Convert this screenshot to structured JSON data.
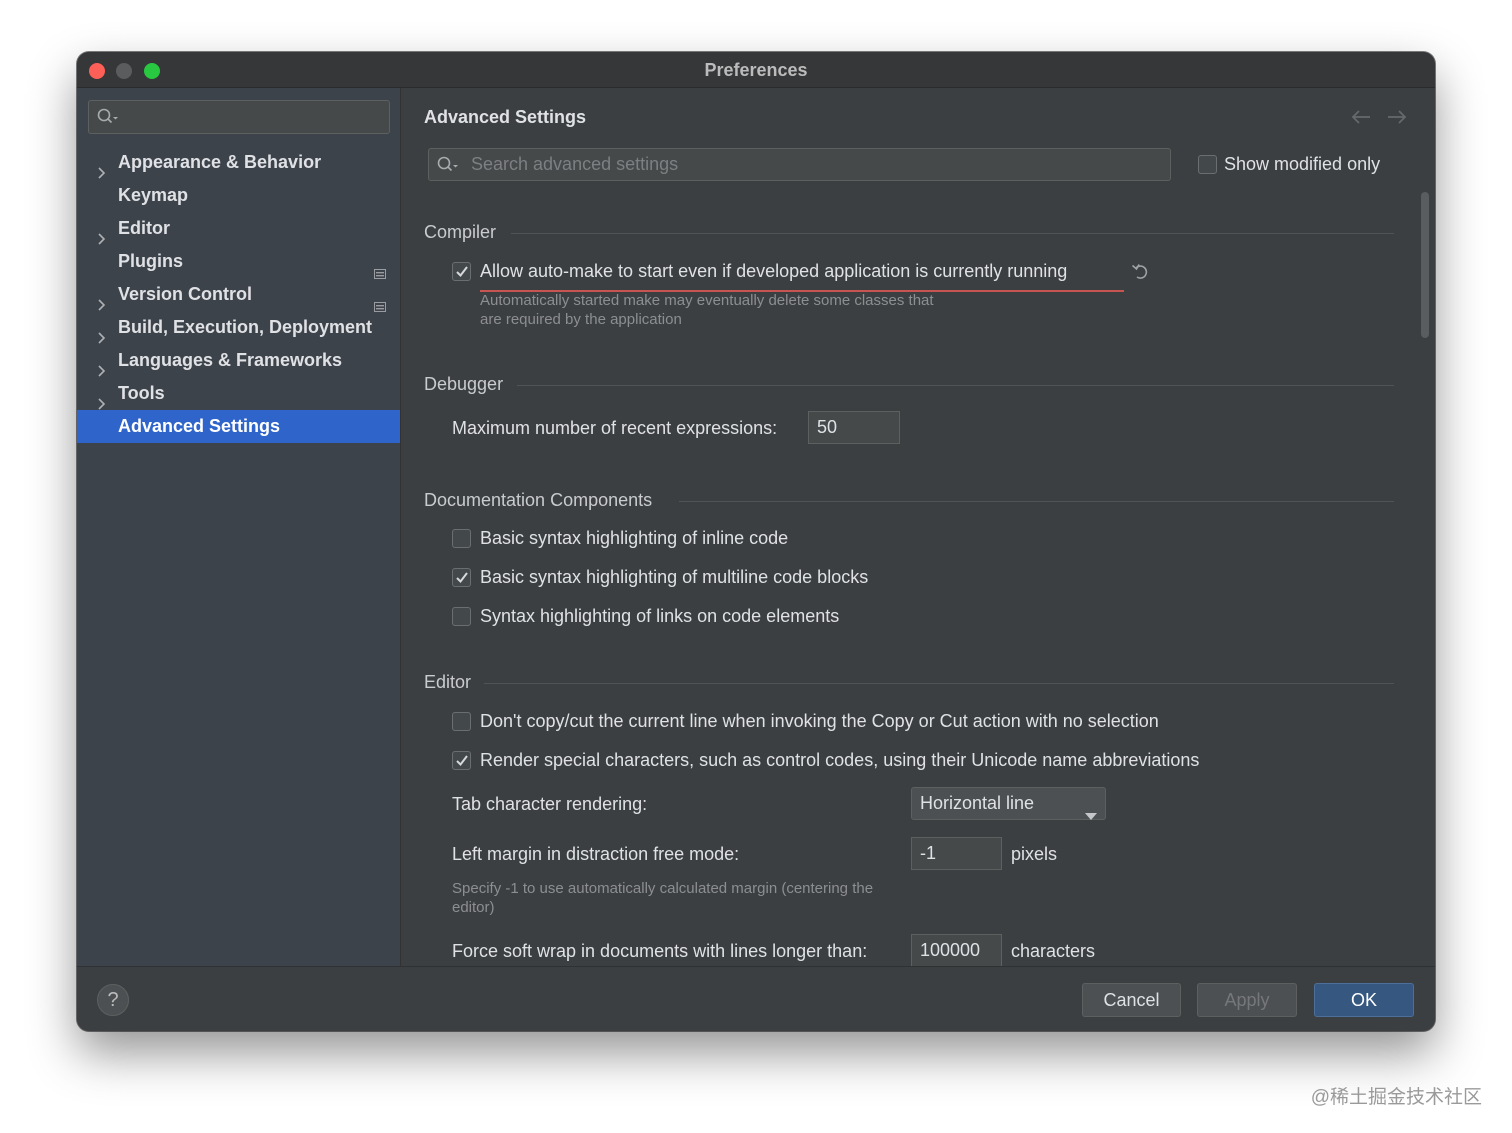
{
  "window": {
    "title": "Preferences"
  },
  "sidebar": {
    "search_placeholder": "",
    "items": [
      {
        "label": "Appearance & Behavior",
        "expandable": true
      },
      {
        "label": "Keymap",
        "expandable": false
      },
      {
        "label": "Editor",
        "expandable": true
      },
      {
        "label": "Plugins",
        "expandable": false
      },
      {
        "label": "Version Control",
        "expandable": true
      },
      {
        "label": "Build, Execution, Deployment",
        "expandable": true
      },
      {
        "label": "Languages & Frameworks",
        "expandable": true
      },
      {
        "label": "Tools",
        "expandable": true
      },
      {
        "label": "Advanced Settings",
        "expandable": false,
        "selected": true
      }
    ]
  },
  "main": {
    "title": "Advanced Settings",
    "search_placeholder": "Search advanced settings",
    "show_modified_label": "Show modified only",
    "show_modified_checked": false,
    "sections": {
      "compiler": {
        "title": "Compiler",
        "automake": {
          "label": "Allow auto-make to start even if developed application is currently running",
          "checked": true,
          "hint_line1": "Automatically started make may eventually delete some classes that",
          "hint_line2": "are required by the application"
        }
      },
      "debugger": {
        "title": "Debugger",
        "max_expr_label": "Maximum number of recent expressions:",
        "max_expr_value": "50"
      },
      "documentation": {
        "title": "Documentation Components",
        "options": [
          {
            "label": "Basic syntax highlighting of inline code",
            "checked": false
          },
          {
            "label": "Basic syntax highlighting of multiline code blocks",
            "checked": true
          },
          {
            "label": "Syntax highlighting of links on code elements",
            "checked": false
          }
        ]
      },
      "editor": {
        "title": "Editor",
        "options": [
          {
            "label": "Don't copy/cut the current line when invoking the Copy or Cut action with no selection",
            "checked": false
          },
          {
            "label": "Render special characters, such as control codes, using their Unicode name abbreviations",
            "checked": true
          }
        ],
        "tab_rendering_label": "Tab character rendering:",
        "tab_rendering_value": "Horizontal line",
        "left_margin_label": "Left margin in distraction free mode:",
        "left_margin_value": "-1",
        "left_margin_unit": "pixels",
        "left_margin_hint_line1": "Specify -1 to use automatically calculated margin (centering the",
        "left_margin_hint_line2": "editor)",
        "soft_wrap_label": "Force soft wrap in documents with lines longer than:",
        "soft_wrap_value": "100000",
        "soft_wrap_unit": "characters"
      }
    }
  },
  "footer": {
    "help_label": "?",
    "cancel_label": "Cancel",
    "apply_label": "Apply",
    "ok_label": "OK"
  },
  "watermark": "@稀土掘金技术社区",
  "colors": {
    "accent": "#2f65ca",
    "primary_button": "#365880",
    "error_underline": "#c75450"
  }
}
